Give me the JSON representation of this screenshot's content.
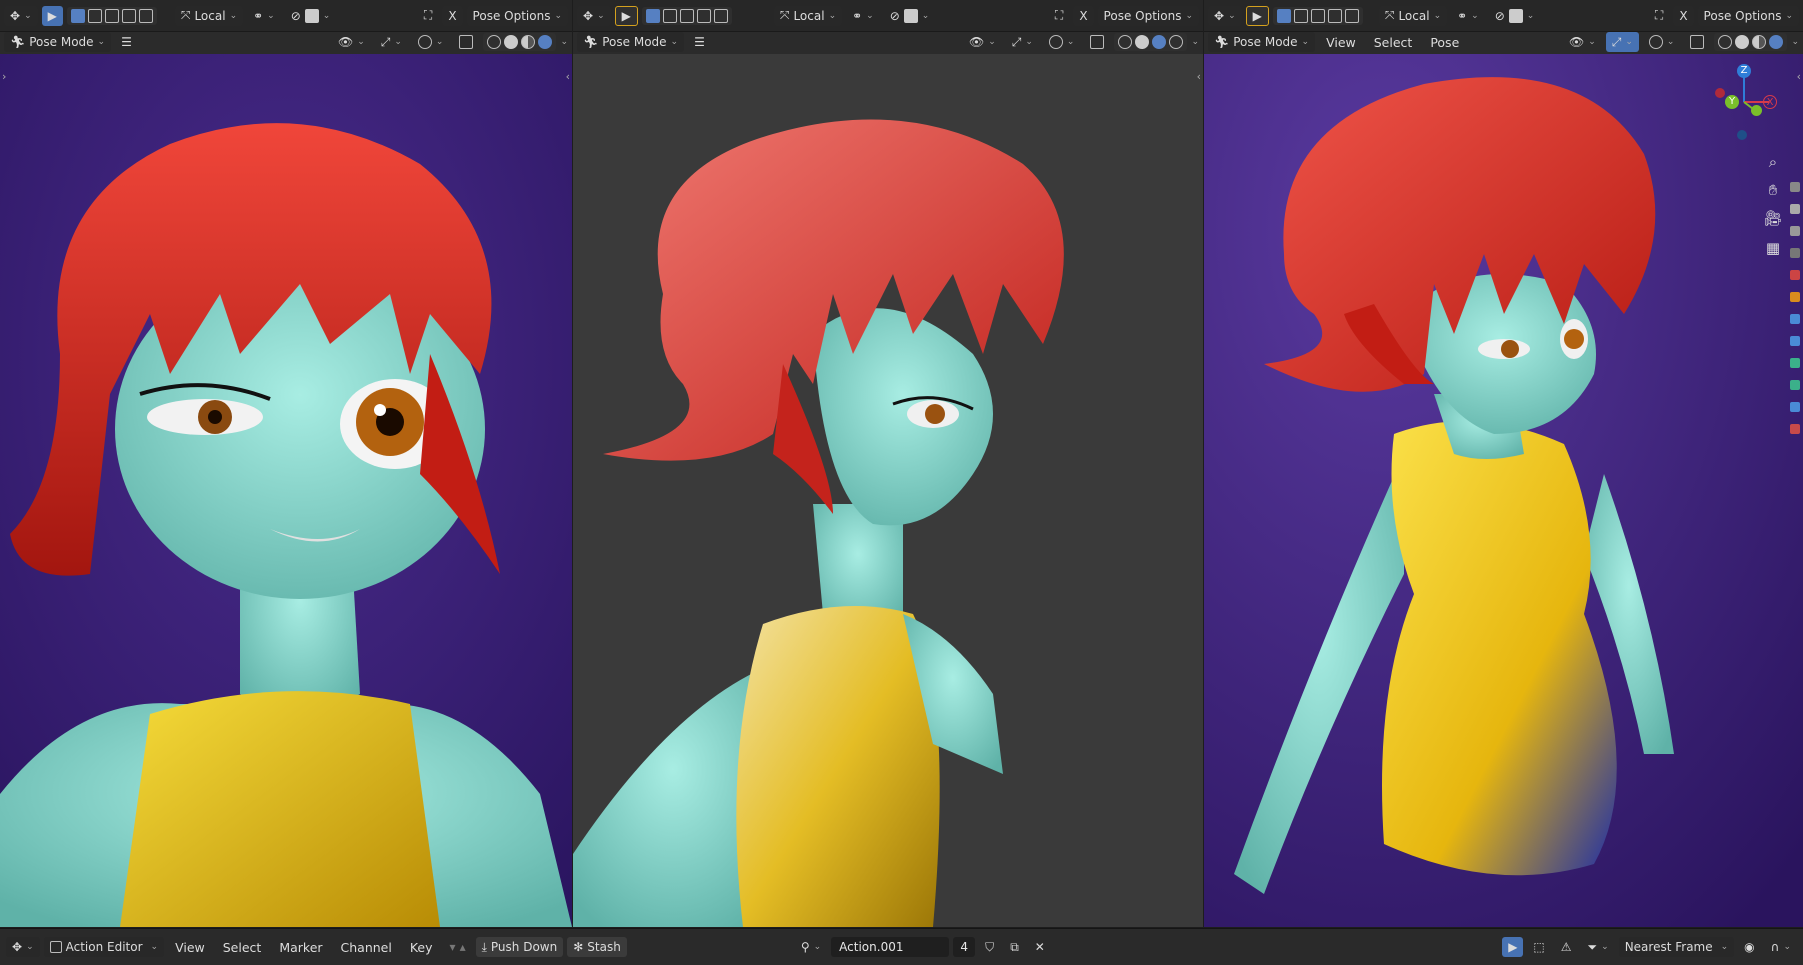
{
  "viewports": [
    {
      "header": {
        "transform_orientation": "Local",
        "options_label": "Pose Options"
      },
      "subheader": {
        "mode_label": "Pose Mode"
      }
    },
    {
      "header": {
        "transform_orientation": "Local",
        "options_label": "Pose Options"
      },
      "subheader": {
        "mode_label": "Pose Mode"
      }
    },
    {
      "header": {
        "transform_orientation": "Local",
        "options_label": "Pose Options"
      },
      "subheader": {
        "mode_label": "Pose Mode",
        "menus": [
          "View",
          "Select",
          "Pose"
        ]
      },
      "gizmo": {
        "z_label": "Z",
        "y_label": "Y",
        "x_label": "X"
      }
    }
  ],
  "bottom_bar": {
    "editor_type": "Action Editor",
    "menus": [
      "View",
      "Select",
      "Marker",
      "Channel",
      "Key"
    ],
    "push_down_label": "Push Down",
    "stash_label": "Stash",
    "action_name": "Action.001",
    "action_users": "4",
    "snap_mode": "Nearest Frame"
  },
  "icons": [
    "editor-type-icon",
    "select-box-icon",
    "transform-pivot-icon",
    "snap-icon",
    "proportional-edit-icon",
    "xray-icon",
    "overlay-icon",
    "gizmo-icon",
    "shading-wireframe-icon",
    "shading-solid-icon",
    "shading-material-icon",
    "shading-rendered-icon",
    "zoom-icon",
    "pan-hand-icon",
    "camera-icon",
    "grid-icon",
    "filter-icon",
    "stash-icon",
    "push-down-icon",
    "close-icon",
    "fake-user-icon",
    "duplicate-icon"
  ],
  "colors": {
    "header_bg": "#282828",
    "accent_blue": "#4772b3",
    "viewport_purple": "#3b1f7a",
    "viewport_grey": "#3a3a3a",
    "skin_teal": "#7ccfc4",
    "hair_red": "#d62a20",
    "dress_yellow": "#e7c21a"
  }
}
